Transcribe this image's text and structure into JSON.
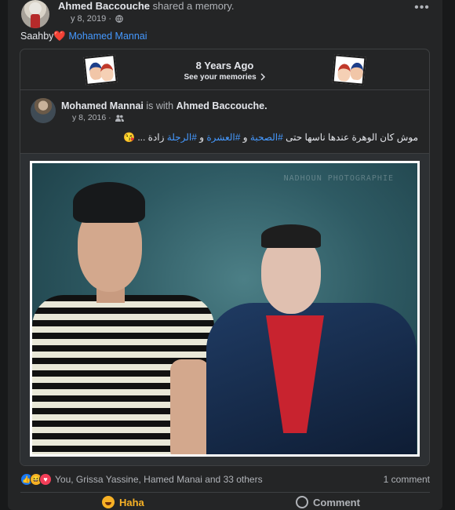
{
  "post": {
    "author": "Ahmed Baccouche",
    "action": "shared a memory.",
    "date": "y 8, 2019 ·",
    "caption_text": "Saahby",
    "caption_heart": "❤️",
    "caption_mention": "Mohamed Mannai",
    "more_icon": "more-horizontal-icon"
  },
  "memory": {
    "title": "8 Years Ago",
    "subtitle": "See your memories",
    "inner_author": "Mohamed Mannai",
    "inner_with": "is with",
    "inner_with_name": "Ahmed Baccouche.",
    "inner_date": "y 8, 2016 ·",
    "inner_text_1": "موش كان الوهرة عندها ناسها حتى ",
    "inner_tag_1": "#الصحبة",
    "inner_text_2": " و ",
    "inner_tag_2": "#العشرة",
    "inner_text_3": " و ",
    "inner_tag_3": "#الرجلة",
    "inner_text_4": " زادة ... 😘",
    "watermark": "NADHOUN PHOTOGRAPHIE"
  },
  "reactions": {
    "names": "You, Grissa Yassine, Hamed Manai and 33 others",
    "comments": "1 comment",
    "icons": [
      "like-icon",
      "haha-icon",
      "love-icon"
    ]
  },
  "actions": {
    "haha_label": "Haha",
    "comment_label": "Comment"
  },
  "colors": {
    "background": "#18191a",
    "card": "#242526",
    "link": "#4599ff",
    "haha": "#f7b125"
  }
}
